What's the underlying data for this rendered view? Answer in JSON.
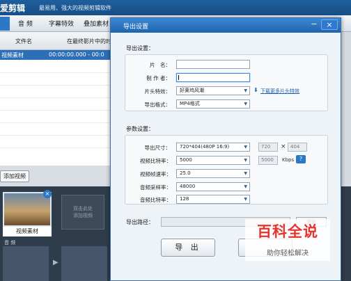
{
  "app": {
    "title": "爱剪辑",
    "subtitle": "最易用、强大的视频剪辑软件"
  },
  "toolbar": {
    "tabs": [
      "音 频",
      "字幕特效",
      "叠加素材"
    ]
  },
  "file_list": {
    "columns": {
      "name": "文件名",
      "range": "在最终影片中的时"
    },
    "rows": [
      {
        "name": "视频素材",
        "range": "00:00:00.000 - 00:0"
      }
    ]
  },
  "add_video_label": "添加视频",
  "timeline": {
    "clip_label": "视频素材",
    "clip_close": "×",
    "drop_hint": "双击此处\n添加视频",
    "audio_label": "音 频",
    "scissor_icon": "✂"
  },
  "dialog": {
    "title": "导出设置",
    "min_symbol": "−",
    "close_symbol": "×",
    "export_settings": {
      "section_title": "导出设置：",
      "film_name_label": "片　名：",
      "film_name_value": "",
      "author_label": "制 作 者：",
      "author_value": "",
      "intro_effect_label": "片头特效：",
      "intro_effect_value": "好莱坞风潮",
      "download_link": "下载更多片头特效",
      "format_label": "导出格式：",
      "format_value": "MP4格式"
    },
    "params": {
      "section_title": "参数设置：",
      "size_label": "导出尺寸：",
      "size_value": "720*404(480P 16:9)",
      "width_value": "720",
      "height_value": "404",
      "times_symbol": "×",
      "video_bitrate_label": "视频比特率：",
      "video_bitrate_value": "5000",
      "video_bitrate_custom": "5000",
      "kbps_label": "Kbps",
      "help_symbol": "?",
      "framerate_label": "视频帧速率：",
      "framerate_value": "25.0",
      "audio_samplerate_label": "音频采样率：",
      "audio_samplerate_value": "48000",
      "audio_bitrate_label": "音频比特率：",
      "audio_bitrate_value": "128"
    },
    "path_label": "导出路径：",
    "path_value": "",
    "browse_label": "浏览",
    "export_button": "导 出",
    "cancel_button": ""
  },
  "watermark": {
    "main": "百科全说",
    "sub": "助你轻松解决"
  },
  "colors": {
    "title_blue": "#1f63ad",
    "selection_blue": "#2d6fb6",
    "watermark_red": "#e8332a"
  }
}
